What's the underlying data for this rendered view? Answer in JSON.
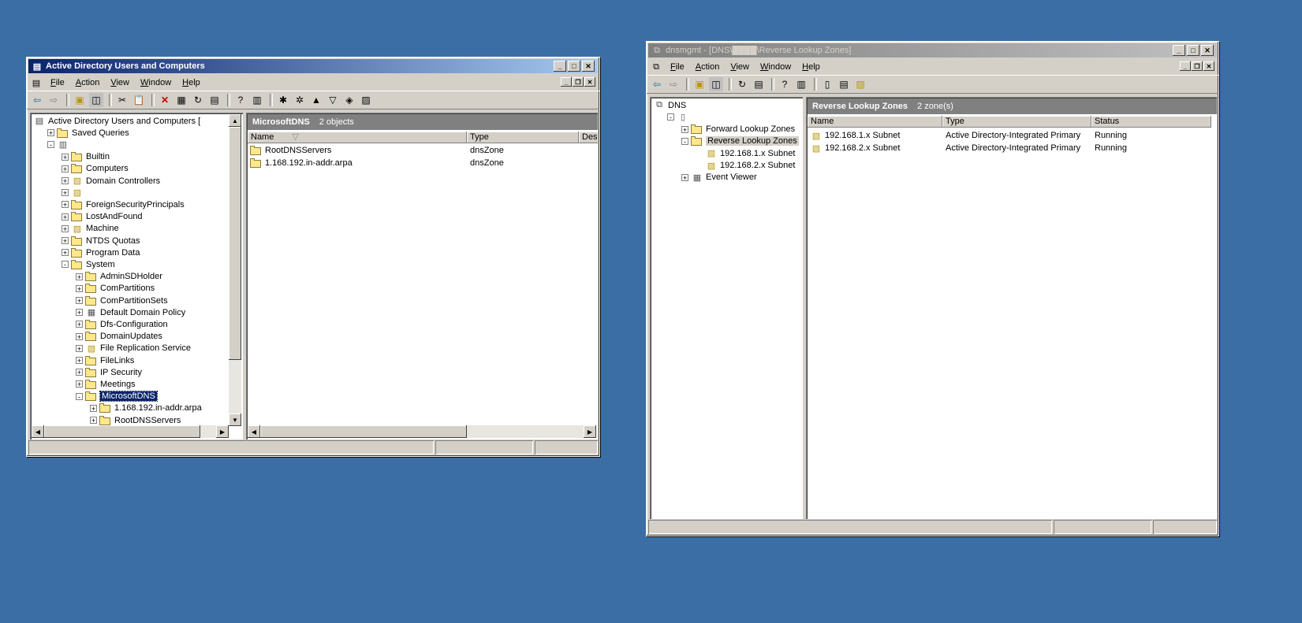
{
  "aduc": {
    "title": "Active Directory Users and Computers",
    "menu": [
      "File",
      "Action",
      "View",
      "Window",
      "Help"
    ],
    "toolbar_icons": [
      "back-icon",
      "forward-icon",
      "up-folder-icon",
      "show-tree-icon",
      "cut-icon",
      "paste-icon",
      "delete-icon",
      "properties-icon",
      "refresh-icon",
      "export-icon",
      "help-icon",
      "mmc-icon",
      "new-user-icon",
      "new-group-icon",
      "new-ou-icon",
      "filter-icon",
      "find-icon",
      "add-to-group-icon"
    ],
    "tree": [
      {
        "label": "Active Directory Users and Computers [",
        "level": 0,
        "icon": "aduc"
      },
      {
        "label": "Saved Queries",
        "level": 1,
        "pm": "+",
        "icon": "folder"
      },
      {
        "label": "",
        "level": 1,
        "pm": "-",
        "icon": "domain"
      },
      {
        "label": "Builtin",
        "level": 2,
        "pm": "+",
        "icon": "folder"
      },
      {
        "label": "Computers",
        "level": 2,
        "pm": "+",
        "icon": "folder"
      },
      {
        "label": "Domain Controllers",
        "level": 2,
        "pm": "+",
        "icon": "ou"
      },
      {
        "label": "",
        "level": 2,
        "pm": "+",
        "icon": "ou"
      },
      {
        "label": "ForeignSecurityPrincipals",
        "level": 2,
        "pm": "+",
        "icon": "folder"
      },
      {
        "label": "LostAndFound",
        "level": 2,
        "pm": "+",
        "icon": "folder"
      },
      {
        "label": "Machine",
        "level": 2,
        "pm": "+",
        "icon": "ou"
      },
      {
        "label": "NTDS Quotas",
        "level": 2,
        "pm": "+",
        "icon": "folder"
      },
      {
        "label": "Program Data",
        "level": 2,
        "pm": "+",
        "icon": "folder"
      },
      {
        "label": "System",
        "level": 2,
        "pm": "-",
        "icon": "folder"
      },
      {
        "label": "AdminSDHolder",
        "level": 3,
        "pm": "+",
        "icon": "folder"
      },
      {
        "label": "ComPartitions",
        "level": 3,
        "pm": "+",
        "icon": "folder"
      },
      {
        "label": "ComPartitionSets",
        "level": 3,
        "pm": "+",
        "icon": "folder"
      },
      {
        "label": "Default Domain Policy",
        "level": 3,
        "pm": "+",
        "icon": "policy"
      },
      {
        "label": "Dfs-Configuration",
        "level": 3,
        "pm": "+",
        "icon": "folder"
      },
      {
        "label": "DomainUpdates",
        "level": 3,
        "pm": "+",
        "icon": "folder"
      },
      {
        "label": "File Replication Service",
        "level": 3,
        "pm": "+",
        "icon": "frs"
      },
      {
        "label": "FileLinks",
        "level": 3,
        "pm": "+",
        "icon": "folder"
      },
      {
        "label": "IP Security",
        "level": 3,
        "pm": "+",
        "icon": "folder"
      },
      {
        "label": "Meetings",
        "level": 3,
        "pm": "+",
        "icon": "folder"
      },
      {
        "label": "MicrosoftDNS",
        "level": 3,
        "pm": "-",
        "icon": "folder",
        "selected": true
      },
      {
        "label": "1.168.192.in-addr.arpa",
        "level": 4,
        "pm": "+",
        "icon": "folder"
      },
      {
        "label": "RootDNSServers",
        "level": 4,
        "pm": "+",
        "icon": "folder"
      }
    ],
    "list_header": {
      "title": "MicrosoftDNS",
      "count": "2 objects"
    },
    "columns": [
      "Name",
      "Type",
      "Desc"
    ],
    "rows": [
      {
        "name": "RootDNSServers",
        "type": "dnsZone"
      },
      {
        "name": "1.168.192.in-addr.arpa",
        "type": "dnsZone"
      }
    ]
  },
  "dns": {
    "title": "dnsmgmt - [DNS\\████\\Reverse Lookup Zones]",
    "menu": [
      "File",
      "Action",
      "View",
      "Window",
      "Help"
    ],
    "toolbar_icons": [
      "back-icon",
      "forward-icon",
      "up-folder-icon",
      "show-tree-icon",
      "refresh-icon",
      "export-icon",
      "help-icon",
      "mmc-icon",
      "server-icon",
      "list-icon",
      "zone-icon"
    ],
    "tree": [
      {
        "label": "DNS",
        "level": 0,
        "icon": "dns"
      },
      {
        "label": "",
        "level": 1,
        "pm": "-",
        "icon": "server"
      },
      {
        "label": "Forward Lookup Zones",
        "level": 2,
        "pm": "+",
        "icon": "folder"
      },
      {
        "label": "Reverse Lookup Zones",
        "level": 2,
        "pm": "-",
        "icon": "folder",
        "selected": true
      },
      {
        "label": "192.168.1.x Subnet",
        "level": 3,
        "icon": "zone"
      },
      {
        "label": "192.168.2.x Subnet",
        "level": 3,
        "icon": "zone"
      },
      {
        "label": "Event Viewer",
        "level": 2,
        "pm": "+",
        "icon": "event"
      }
    ],
    "list_header": {
      "title": "Reverse Lookup Zones",
      "count": "2 zone(s)"
    },
    "columns": [
      "Name",
      "Type",
      "Status"
    ],
    "rows": [
      {
        "name": "192.168.1.x Subnet",
        "type": "Active Directory-Integrated Primary",
        "status": "Running"
      },
      {
        "name": "192.168.2.x Subnet",
        "type": "Active Directory-Integrated Primary",
        "status": "Running"
      }
    ]
  }
}
